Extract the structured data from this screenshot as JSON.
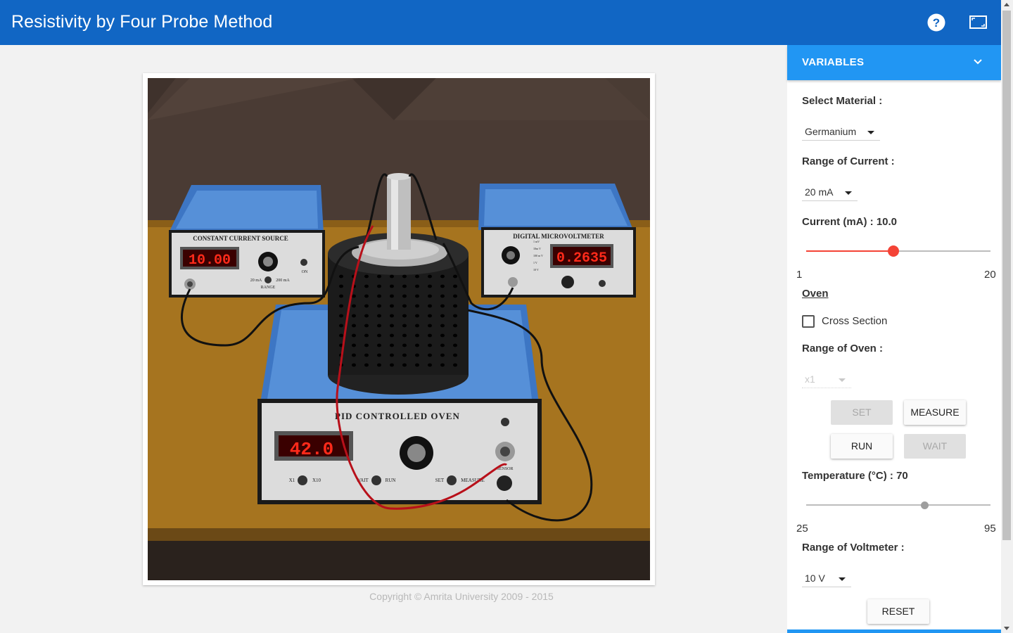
{
  "app": {
    "title": "Resistivity by Four Probe Method",
    "help_icon": "help-circle-icon",
    "fullscreen_icon": "fullscreen-icon"
  },
  "scene": {
    "current_source_label": "CONSTANT CURRENT SOURCE",
    "current_source_display": "10.00",
    "current_source_on": "ON",
    "current_source_range_low": "20 mA",
    "current_source_range_high": "200 mA",
    "current_source_range": "RANGE",
    "voltmeter_label": "DIGITAL MICROVOLTMETER",
    "voltmeter_display": "0.2635",
    "voltmeter_ranges": [
      "1 mV",
      "10m V",
      "100 m V",
      "1 V",
      "10 V"
    ],
    "oven_label": "PID CONTROLLED OVEN",
    "oven_display": "42.0",
    "oven_x1": "X1",
    "oven_x10": "X10",
    "oven_wait": "WAIT",
    "oven_run": "RUN",
    "oven_set": "SET",
    "oven_measure": "MEASURE",
    "oven_sensor": "SENSOR"
  },
  "copyright": "Copyright © Amrita University 2009 - 2015",
  "panel": {
    "header": "VARIABLES",
    "select_material_label": "Select Material :",
    "material_value": "Germanium",
    "range_current_label": "Range of Current :",
    "range_current_value": "20 mA",
    "current_label": "Current (mA) : 10.0",
    "current_min": "1",
    "current_max": "20",
    "current_fraction": 0.474,
    "oven_link": "Oven",
    "cross_section_label": "Cross Section",
    "range_oven_label": "Range of Oven :",
    "range_oven_value": "x1",
    "btn_set": "SET",
    "btn_measure": "MEASURE",
    "btn_run": "RUN",
    "btn_wait": "WAIT",
    "temperature_label": "Temperature (°C) : 70",
    "temp_min": "25",
    "temp_max": "95",
    "temp_fraction": 0.643,
    "range_voltmeter_label": "Range of Voltmeter :",
    "range_voltmeter_value": "10 V",
    "btn_reset": "RESET"
  },
  "colors": {
    "topbar": "#1166c4",
    "panel_header": "#2196f3",
    "slider_active": "#f44336",
    "slider_disabled": "#9e9e9e",
    "display_red": "#ff2a1a"
  }
}
